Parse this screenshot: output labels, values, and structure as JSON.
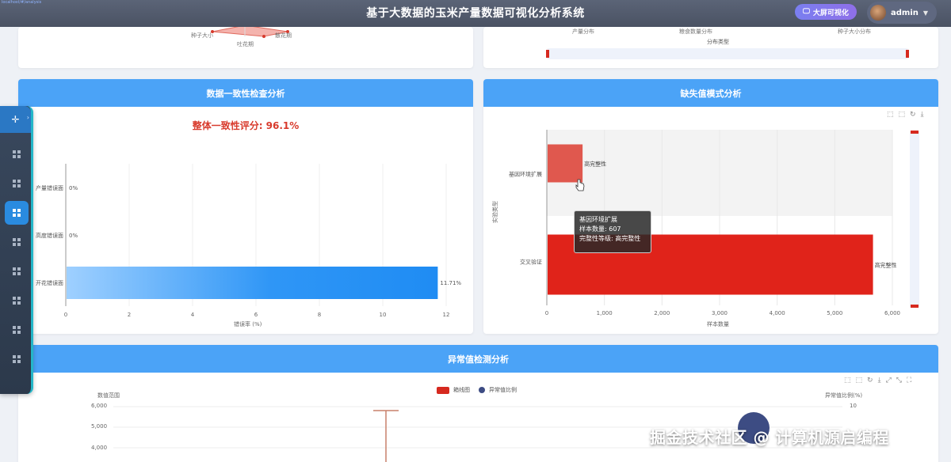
{
  "header": {
    "url_fragment": "localhost/#/analysis",
    "title": "基于大数据的玉米产量数据可视化分析系统",
    "bigscreen_label": "大屏可视化",
    "user_name": "admin"
  },
  "top_left_card": {
    "radar_labels": [
      "种子大小",
      "吐花期",
      "散花期"
    ]
  },
  "top_right_card": {
    "categories": [
      "产量分布",
      "粮食数量分布",
      "种子大小分布"
    ],
    "xlabel": "分布类型"
  },
  "consistency_card": {
    "title": "数据一致性检查分析",
    "score_text": "整体一致性评分: 96.1%",
    "chart_data": {
      "type": "bar",
      "orientation": "horizontal",
      "categories": [
        "开花错误面",
        "高度错误面",
        "产量错误面"
      ],
      "values": [
        11.71,
        0,
        0
      ],
      "value_labels": [
        "11.71%",
        "0%",
        "0%"
      ],
      "xlabel": "错误率 (%)",
      "xlim": [
        0,
        12
      ],
      "xticks": [
        "0",
        "2",
        "4",
        "6",
        "8",
        "10",
        "12"
      ]
    }
  },
  "missing_card": {
    "title": "缺失值模式分析",
    "toolbox_icons": [
      "zoom-icon",
      "zoom-reset-icon",
      "restore-icon",
      "download-icon"
    ],
    "chart_data": {
      "type": "bar",
      "orientation": "horizontal",
      "categories": [
        "基因环境扩展",
        "交叉验证"
      ],
      "values": [
        607,
        5650
      ],
      "bar_labels": [
        "高完整性",
        "高完整性"
      ],
      "colors": [
        "#e0584e",
        "#e0231a"
      ],
      "xlabel": "样本数量",
      "ylabel": "实验类型",
      "xlim": [
        0,
        6000
      ],
      "xticks": [
        "0",
        "1,000",
        "2,000",
        "3,000",
        "4,000",
        "5,000",
        "6,000"
      ]
    },
    "tooltip": {
      "title": "基因环境扩展",
      "line1": "样本数量: 607",
      "line2": "完整性等级: 高完整性"
    }
  },
  "anomaly_card": {
    "title": "异常值检测分析",
    "toolbox_icons": [
      "zoom-icon",
      "zoom-reset-icon",
      "restore-icon",
      "download-icon",
      "expand-icon",
      "shrink-icon",
      "fullscreen-icon"
    ],
    "legend": [
      "箱线图",
      "异常值比例"
    ],
    "left_axis_name": "数值范围",
    "right_axis_name": "异常值比例(%)",
    "yticks_left": [
      "6,000",
      "5,000",
      "4,000"
    ],
    "ytick_right": "10"
  },
  "sidebar": {
    "item_count": 8,
    "active_index": 2
  },
  "watermark": "掘金技术社区 @ 计算机源启编程",
  "colors": {
    "header": "#4f586a",
    "card_head": "#4ba3f7",
    "accent_red": "#e0231a",
    "bar_blue": "#1e8ff5"
  }
}
